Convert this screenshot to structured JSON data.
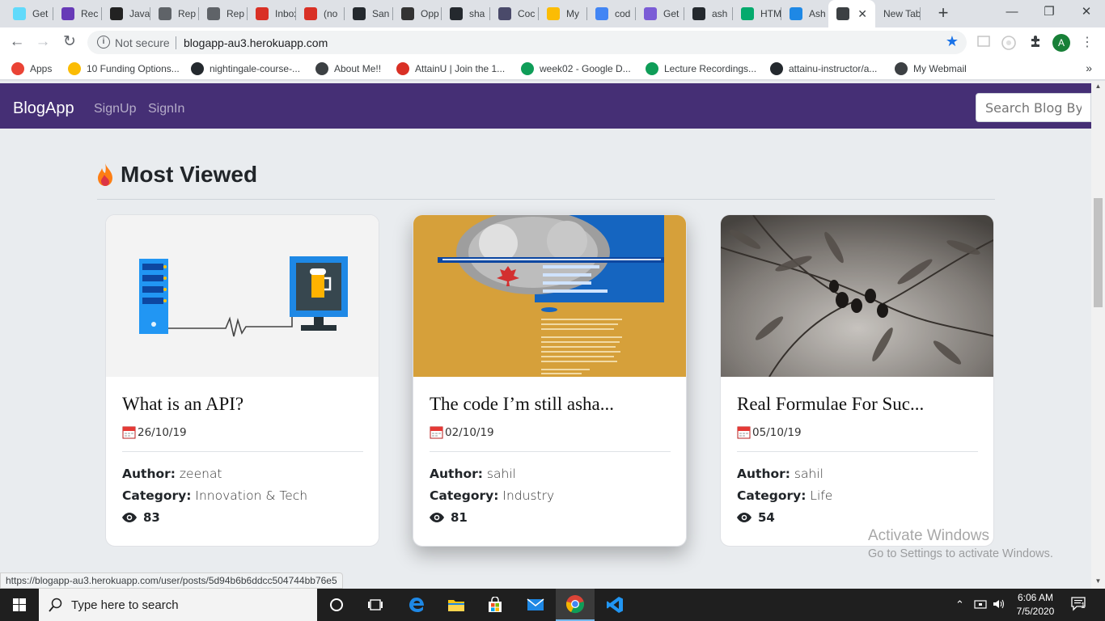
{
  "browser": {
    "tabs": [
      {
        "title": "Get",
        "icon": "react-icon",
        "color": "#61dafb"
      },
      {
        "title": "Rec",
        "icon": "forms-icon",
        "color": "#673ab7"
      },
      {
        "title": "Java",
        "icon": "code-icon",
        "color": "#222222"
      },
      {
        "title": "Rep",
        "icon": "replit-icon",
        "color": "#5f6368"
      },
      {
        "title": "Rep",
        "icon": "replit-icon",
        "color": "#5f6368"
      },
      {
        "title": "Inbox",
        "icon": "gmail-icon",
        "color": "#d93025"
      },
      {
        "title": "(no",
        "icon": "gmail-icon",
        "color": "#d93025"
      },
      {
        "title": "San",
        "icon": "github-icon",
        "color": "#24292e"
      },
      {
        "title": "Opp",
        "icon": "ih-icon",
        "color": "#333333"
      },
      {
        "title": "sha",
        "icon": "github-icon",
        "color": "#24292e"
      },
      {
        "title": "Coc",
        "icon": "cube-icon",
        "color": "#4a4a6a"
      },
      {
        "title": "My",
        "icon": "drive-icon",
        "color": "#fbbc04"
      },
      {
        "title": "cod",
        "icon": "google-icon",
        "color": "#4285f4"
      },
      {
        "title": "Get",
        "icon": "shield-icon",
        "color": "#7b5cd6"
      },
      {
        "title": "ash",
        "icon": "github-icon",
        "color": "#24292e"
      },
      {
        "title": "HTML",
        "icon": "w3-icon",
        "color": "#04aa6d"
      },
      {
        "title": "Ash",
        "icon": "react-icon",
        "color": "#1e88e5"
      },
      {
        "title": "",
        "icon": "globe-icon",
        "color": "#3c4043",
        "active": true
      },
      {
        "title": "New Tab",
        "icon": "",
        "color": ""
      }
    ],
    "close_glyph": "✕",
    "new_tab_glyph": "+",
    "url_not_secure": "Not secure",
    "url": "blogapp-au3.herokuapp.com",
    "profile_initial": "A",
    "bookmarks": [
      {
        "label": "Apps",
        "icon": "apps-grid-icon"
      },
      {
        "label": "10 Funding Options...",
        "icon": "pinwheel-icon"
      },
      {
        "label": "nightingale-course-...",
        "icon": "github-icon"
      },
      {
        "label": "About Me!!",
        "icon": "globe-icon"
      },
      {
        "label": "AttainU | Join the 1...",
        "icon": "gmail-icon"
      },
      {
        "label": "week02 - Google D...",
        "icon": "drive-icon"
      },
      {
        "label": "Lecture Recordings...",
        "icon": "drive-icon"
      },
      {
        "label": "attainu-instructor/a...",
        "icon": "github-icon"
      },
      {
        "label": "My Webmail",
        "icon": "globe-icon"
      }
    ],
    "bookmarks_more": "»",
    "status_url": "https://blogapp-au3.herokuapp.com/user/posts/5d94b6b6ddcc504744bb76e5"
  },
  "site": {
    "brand": "BlogApp",
    "nav": [
      "SignUp",
      "SignIn"
    ],
    "search_placeholder": "Search Blog By Name",
    "section_title": "Most Viewed",
    "author_label": "Author:",
    "category_label": "Category:",
    "posts": [
      {
        "title": "What is an API?",
        "date": "26/10/19",
        "author": "zeenat",
        "category": "Innovation & Tech",
        "views": "83",
        "image": "api-illustration"
      },
      {
        "title": "The code I’m still asha...",
        "date": "02/10/19",
        "author": "sahil",
        "category": "Industry",
        "views": "81",
        "image": "brochure-photo"
      },
      {
        "title": "Real Formulae For Suc...",
        "date": "05/10/19",
        "author": "sahil",
        "category": "Life",
        "views": "54",
        "image": "olive-branch-photo"
      }
    ]
  },
  "watermark": {
    "line1": "Activate Windows",
    "line2": "Go to Settings to activate Windows."
  },
  "taskbar": {
    "search_placeholder": "Type here to search",
    "time": "6:06 AM",
    "date": "7/5/2020",
    "notification_count": "1"
  },
  "colors": {
    "navbar": "#452f75",
    "flame": "#fd7e14",
    "page_bg": "#e9ecef"
  }
}
